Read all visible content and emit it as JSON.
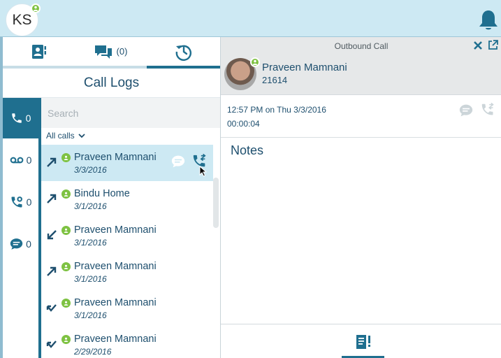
{
  "user": {
    "initials": "KS"
  },
  "tabs": [
    {
      "icon": "contact-card-icon",
      "count": ""
    },
    {
      "icon": "chat-bubbles-icon",
      "count": "(0)"
    },
    {
      "icon": "history-clock-icon",
      "count": ""
    }
  ],
  "panel_title": "Call Logs",
  "filters": [
    {
      "icon": "phone-icon",
      "count": "0"
    },
    {
      "icon": "voicemail-icon",
      "count": "0"
    },
    {
      "icon": "missed-call-icon",
      "count": "0"
    },
    {
      "icon": "message-icon",
      "count": "0"
    }
  ],
  "search": {
    "placeholder": "Search"
  },
  "call_filter": {
    "selected": "All calls"
  },
  "calls": [
    {
      "name": "Praveen Mamnani",
      "date": "3/3/2016",
      "direction": "outgoing"
    },
    {
      "name": "Bindu Home",
      "date": "3/1/2016",
      "direction": "outgoing"
    },
    {
      "name": "Praveen Mamnani",
      "date": "3/1/2016",
      "direction": "incoming"
    },
    {
      "name": "Praveen Mamnani",
      "date": "3/1/2016",
      "direction": "outgoing"
    },
    {
      "name": "Praveen Mamnani",
      "date": "3/1/2016",
      "direction": "missed"
    },
    {
      "name": "Praveen Mamnani",
      "date": "2/29/2016",
      "direction": "missed"
    }
  ],
  "detail": {
    "header": "Outbound Call",
    "contact_name": "Praveen Mamnani",
    "contact_ext": "21614",
    "call_time": "12:57 PM on Thu 3/3/2016",
    "duration": "00:00:04",
    "notes_label": "Notes"
  },
  "colors": {
    "brand": "#1f6f8f",
    "header_bg": "#cde9f3",
    "presence": "#7ec242"
  }
}
